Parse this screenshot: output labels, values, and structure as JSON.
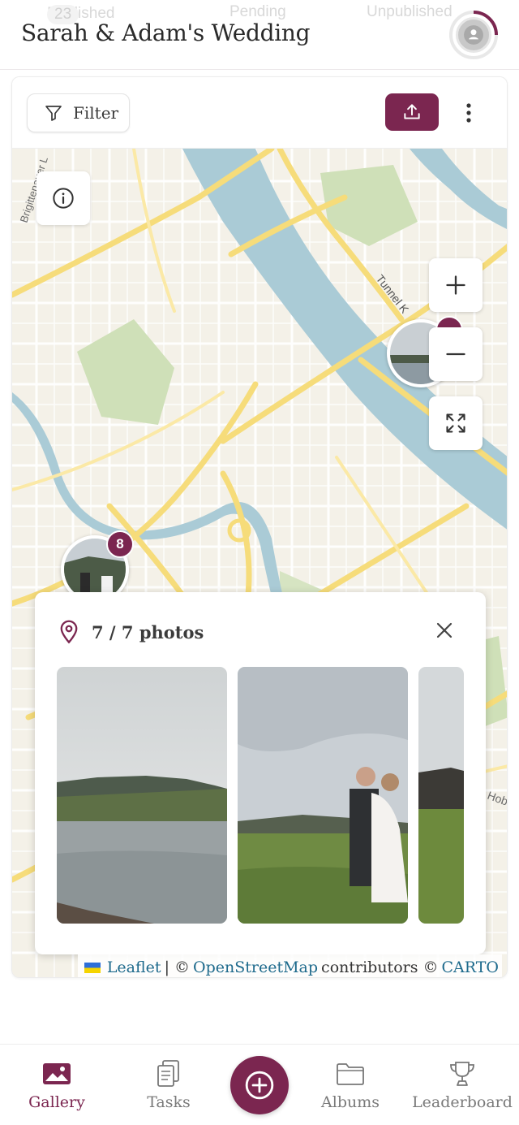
{
  "header": {
    "title": "Sarah & Adam's Wedding",
    "faded_tabs": [
      {
        "label": "Published",
        "count": "23"
      },
      {
        "label": "Pending"
      },
      {
        "label": "Unpublished"
      }
    ]
  },
  "toolbar": {
    "filter_label": "Filter",
    "upload_icon": "upload-icon",
    "more_icon": "more-vertical-icon"
  },
  "map": {
    "street_labels": [
      "Brigittenauer L",
      "Tunnel K",
      "Hoba"
    ],
    "clusters": [
      {
        "count": "8"
      },
      {
        "count": ""
      }
    ],
    "controls": {
      "zoom_in": "+",
      "zoom_out": "−"
    },
    "attribution": {
      "leaflet": "Leaflet",
      "sep": "| ©",
      "osm": "OpenStreetMap",
      "contributors": "contributors ©",
      "carto": "CARTO"
    }
  },
  "popup": {
    "title": "7 / 7 photos",
    "photos": [
      "lake-landscape",
      "couple-portrait",
      "cabin-field"
    ]
  },
  "bottom_nav": {
    "items": [
      {
        "label": "Gallery",
        "icon": "gallery-icon",
        "active": true
      },
      {
        "label": "Tasks",
        "icon": "tasks-icon"
      },
      {
        "label": "Albums",
        "icon": "albums-icon"
      },
      {
        "label": "Leaderboard",
        "icon": "trophy-icon"
      }
    ],
    "fab_icon": "add-icon"
  },
  "colors": {
    "accent": "#7b2650",
    "map_water": "#aacbd6",
    "map_park": "#cfe0b8",
    "map_road": "#f6dc7a",
    "map_land": "#f4f1e8"
  }
}
